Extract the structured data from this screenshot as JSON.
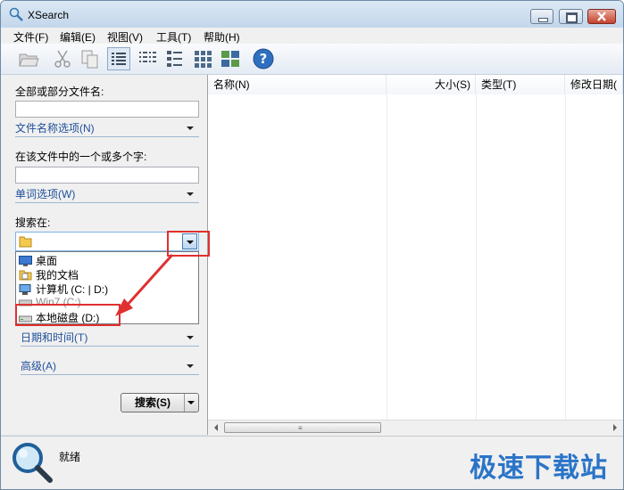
{
  "window": {
    "title": "XSearch"
  },
  "menu": [
    "文件(F)",
    "编辑(E)",
    "视图(V)",
    "工具(T)",
    "帮助(H)"
  ],
  "toolbar": [
    "open-folder-icon",
    "cut-icon",
    "copy-icon",
    "details-view-icon",
    "list-view-icon",
    "small-icons-view-icon",
    "thumbnails-view-icon",
    "tiles-view-icon",
    "help-icon"
  ],
  "left": {
    "filename_label": "全部或部分文件名:",
    "filename_value": "",
    "filename_options": "文件名称选项(N)",
    "text_label": "在该文件中的一个或多个字:",
    "text_value": "",
    "word_options": "单词选项(W)",
    "searchin_label": "搜索在:",
    "searchin_value": "",
    "dropdown_items": [
      "桌面",
      "我的文档",
      "计算机 (C: | D:)",
      "Win7 (C:)",
      "本地磁盘 (D:)"
    ],
    "date_options": "日期和时间(T)",
    "advanced_options": "高级(A)",
    "search_button": "搜索(S)"
  },
  "results": {
    "columns": [
      "名称(N)",
      "大小(S)",
      "类型(T)",
      "修改日期("
    ]
  },
  "status": {
    "text": "就绪"
  },
  "watermark": "极速下载站",
  "colors": {
    "highlight_red": "#e03030",
    "link_blue": "#1f4f9a"
  }
}
